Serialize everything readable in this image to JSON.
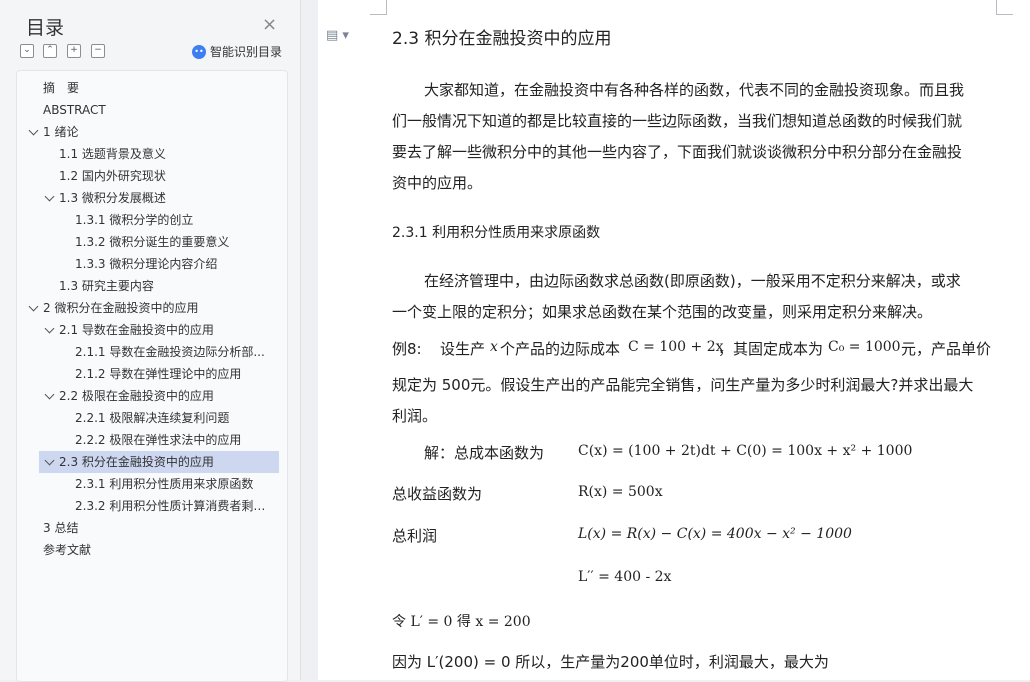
{
  "sidebar": {
    "title": "目录",
    "close_icon": "close-icon",
    "ai_label": "智能识别目录",
    "toc": [
      {
        "label": "摘　要"
      },
      {
        "label": "ABSTRACT"
      },
      {
        "label": "1 绪论"
      },
      {
        "label": "1.1 选题背景及意义"
      },
      {
        "label": "1.2 国内外研究现状"
      },
      {
        "label": "1.3 微积分发展概述"
      },
      {
        "label": "1.3.1 微积分学的创立"
      },
      {
        "label": "1.3.2 微积分诞生的重要意义"
      },
      {
        "label": "1.3.3 微积分理论内容介绍"
      },
      {
        "label": "1.3 研究主要内容"
      },
      {
        "label": "2 微积分在金融投资中的应用"
      },
      {
        "label": "2.1 导数在金融投资中的应用"
      },
      {
        "label": "2.1.1 导数在金融投资边际分析部..."
      },
      {
        "label": "2.1.2 导数在弹性理论中的应用"
      },
      {
        "label": "2.2 极限在金融投资中的应用"
      },
      {
        "label": "2.2.1 极限解决连续复利问题"
      },
      {
        "label": "2.2.2 极限在弹性求法中的应用"
      },
      {
        "label": "2.3 积分在金融投资中的应用"
      },
      {
        "label": "2.3.1 利用积分性质用来求原函数"
      },
      {
        "label": "2.3.2 利用积分性质计算消费者剩 ..."
      },
      {
        "label": "3 总结"
      },
      {
        "label": "参考文献"
      }
    ]
  },
  "doc": {
    "heading": "2.3 积分在金融投资中的应用",
    "para1": [
      "大家都知道，在金融投资中有各种各样的函数，代表不同的金融投资现象。而且我",
      "们一般情况下知道的都是比较直接的一些边际函数，当我们想知道总函数的时候我们就",
      "要去了解一些微积分中的其他一些内容了，下面我们就谈谈微积分中积分部分在金融投",
      "资中的应用。"
    ],
    "subheading": "2.3.1 利用积分性质用来求原函数",
    "para2": [
      "在经济管理中，由边际函数求总函数(即原函数)，一般采用不定积分来解决，或求",
      "一个变上限的定积分；如果求总函数在某个范围的改变量，则采用定积分来解决。"
    ],
    "example_label": "例8:",
    "example_line1_a": "设生产",
    "example_line1_x": "x",
    "example_line1_b": "个产品的边际成本",
    "example_line1_formula": "C = 100 + 2x",
    "example_line1_c": "，其固定成本为",
    "example_line1_c0": "C₀ = 1000",
    "example_line1_d": "元，产品单价",
    "example_line2": "规定为 500元。假设生产出的产品能完全销售，问生产量为多少时利润最大?并求出最大",
    "example_line3": "利润。",
    "sol_label": "解：总成本函数为",
    "sol_formula": "C(x) = (100 + 2t)dt + C(0) = 100x + x² + 1000",
    "rev_label": "总收益函数为",
    "rev_formula": "R(x) = 500x",
    "profit_label": "总利润",
    "profit_formula": "L(x) = R(x) − C(x) = 400x − x² − 1000",
    "deriv_formula": "L′′ = 400 - 2x",
    "let_text": "令 L′ = 0 得   x = 200",
    "because_text": "因为 L′(200) = 0 所以，生产量为200单位时，利润最大，最大为"
  }
}
